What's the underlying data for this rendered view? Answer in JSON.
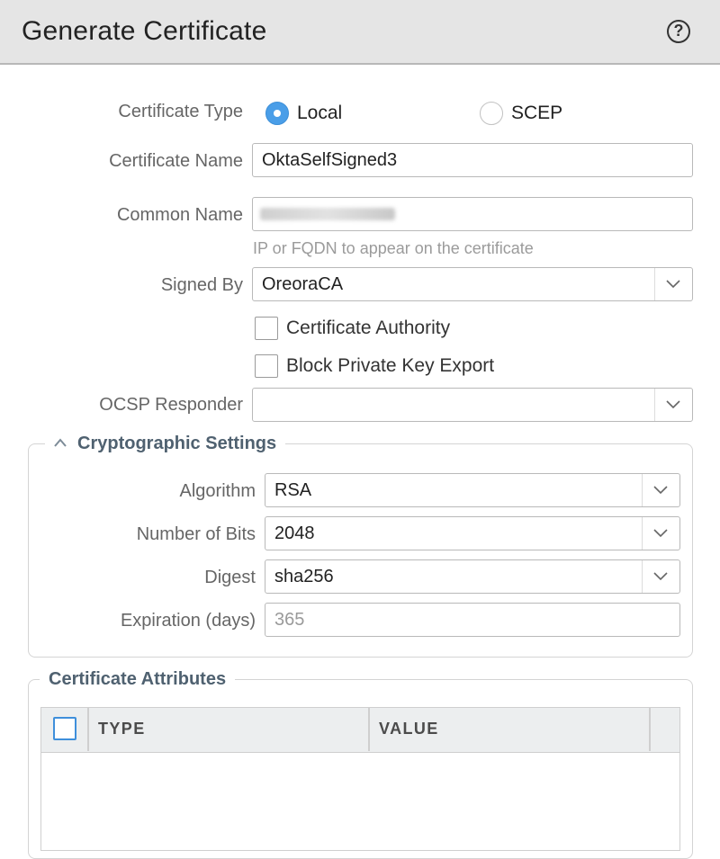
{
  "dialog": {
    "title": "Generate Certificate",
    "help_icon": "question-circle-icon",
    "help_glyph": "?"
  },
  "form": {
    "certificate_type": {
      "label": "Certificate Type",
      "options": [
        {
          "label": "Local",
          "selected": true
        },
        {
          "label": "SCEP",
          "selected": false
        }
      ]
    },
    "certificate_name": {
      "label": "Certificate Name",
      "value": "OktaSelfSigned3"
    },
    "common_name": {
      "label": "Common Name",
      "value_redacted": true,
      "hint": "IP or FQDN to appear on the certificate"
    },
    "signed_by": {
      "label": "Signed By",
      "value": "OreoraCA"
    },
    "certificate_authority": {
      "label": "Certificate Authority",
      "checked": false
    },
    "block_private_key_export": {
      "label": "Block Private Key Export",
      "checked": false
    },
    "ocsp_responder": {
      "label": "OCSP Responder",
      "value": ""
    }
  },
  "crypto": {
    "legend": "Cryptographic Settings",
    "collapse_icon": "chevron-up-icon",
    "algorithm": {
      "label": "Algorithm",
      "value": "RSA"
    },
    "bits": {
      "label": "Number of Bits",
      "value": "2048"
    },
    "digest": {
      "label": "Digest",
      "value": "sha256"
    },
    "expiration": {
      "label": "Expiration (days)",
      "placeholder": "365"
    }
  },
  "attributes": {
    "legend": "Certificate Attributes",
    "columns": [
      "TYPE",
      "VALUE"
    ],
    "rows": []
  },
  "colors": {
    "accent": "#4a9ee8",
    "titlebar": "#e5e5e5",
    "legend_text": "#4f6170"
  }
}
